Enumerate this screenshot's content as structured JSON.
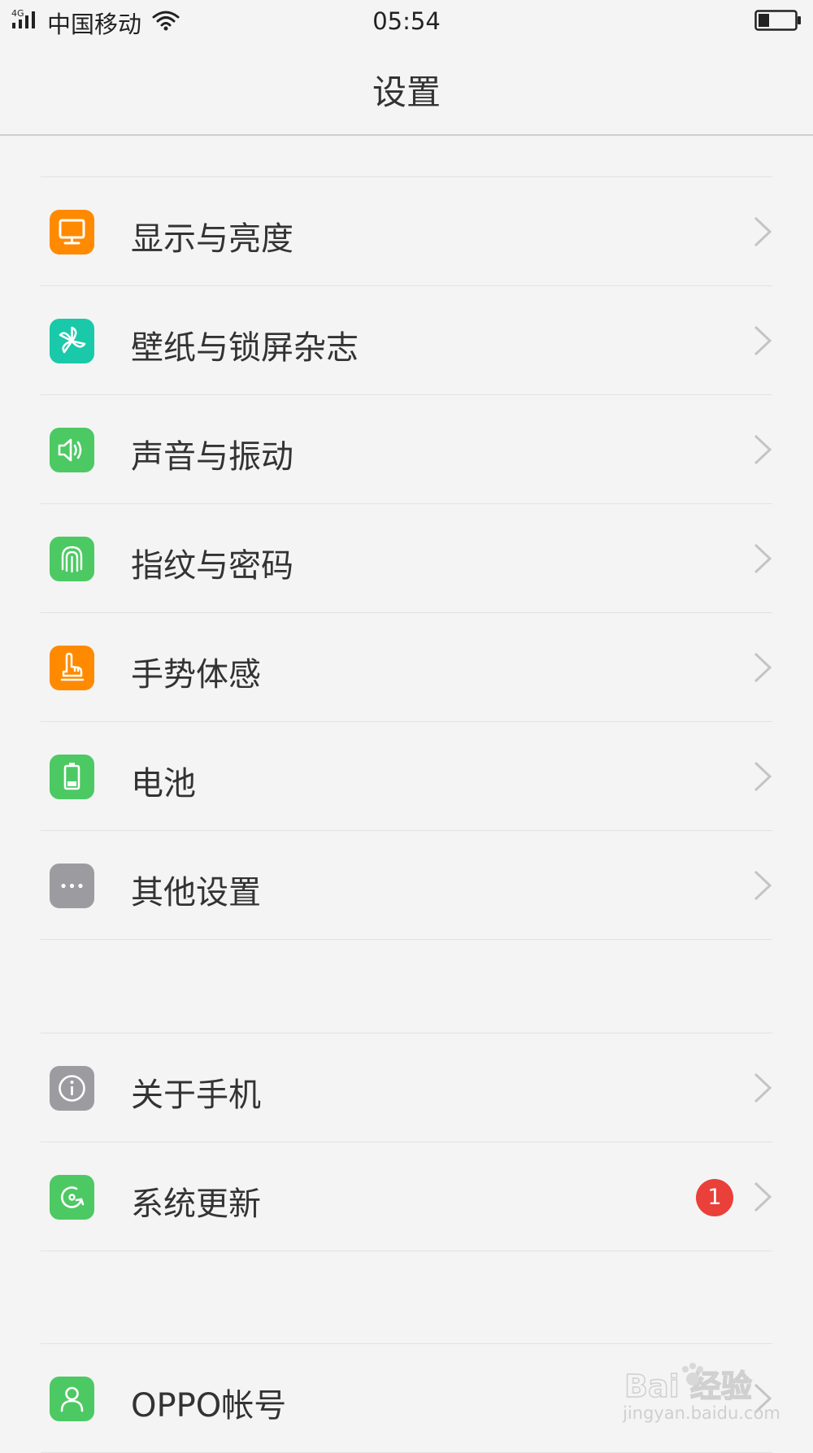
{
  "status_bar": {
    "network_type": "4G",
    "carrier": "中国移动",
    "time": "05:54"
  },
  "header": {
    "title": "设置"
  },
  "groups": [
    {
      "items": [
        {
          "label": "显示与亮度",
          "icon": "display-icon",
          "icon_color": "#ff8a00"
        },
        {
          "label": "壁纸与锁屏杂志",
          "icon": "pinwheel-icon",
          "icon_color": "#1ac9a9"
        },
        {
          "label": "声音与振动",
          "icon": "speaker-icon",
          "icon_color": "#4cc963"
        },
        {
          "label": "指纹与密码",
          "icon": "fingerprint-icon",
          "icon_color": "#4cc963"
        },
        {
          "label": "手势体感",
          "icon": "hand-gesture-icon",
          "icon_color": "#ff8a00"
        },
        {
          "label": "电池",
          "icon": "battery-icon",
          "icon_color": "#4cc963"
        },
        {
          "label": "其他设置",
          "icon": "more-dots-icon",
          "icon_color": "#9c9ca0"
        }
      ]
    },
    {
      "items": [
        {
          "label": "关于手机",
          "icon": "info-icon",
          "icon_color": "#9c9ca0"
        },
        {
          "label": "系统更新",
          "icon": "update-icon",
          "icon_color": "#4cc963",
          "badge": "1",
          "badge_color": "#e9403a"
        }
      ]
    },
    {
      "items": [
        {
          "label": "OPPO帐号",
          "icon": "account-icon",
          "icon_color": "#4cc963"
        }
      ]
    }
  ],
  "watermark": {
    "brand": "Bai 经验",
    "url": "jingyan.baidu.com"
  }
}
